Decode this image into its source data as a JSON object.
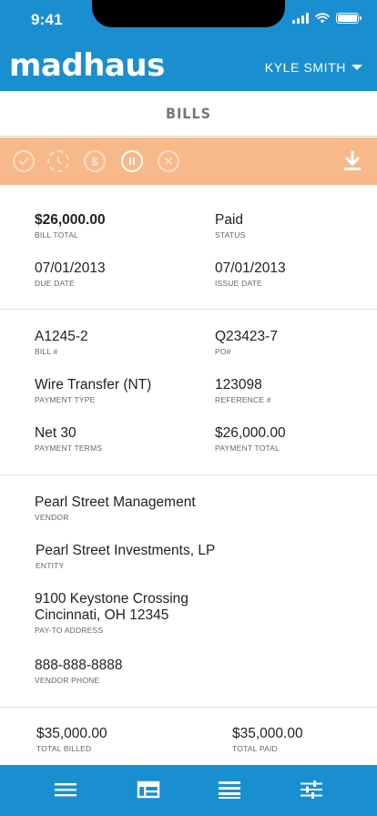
{
  "status_bar": {
    "time": "9:41"
  },
  "header": {
    "logo": "madhaus",
    "user_name": "KYLE SMITH",
    "brand_color": "#1a8fd0"
  },
  "page": {
    "title": "BILLS"
  },
  "action_bar": {
    "background": "#f7b98a",
    "actions": [
      "approve-icon",
      "pending-icon",
      "pay-icon",
      "hold-icon",
      "void-icon"
    ],
    "active_action": "hold-icon",
    "download_icon": "download-icon"
  },
  "summary": {
    "bill_total": {
      "value": "$26,000.00",
      "label": "BILL TOTAL"
    },
    "status": {
      "value": "Paid",
      "label": "STATUS"
    },
    "due_date": {
      "value": "07/01/2013",
      "label": "DUE DATE"
    },
    "issue_date": {
      "value": "07/01/2013",
      "label": "ISSUE DATE"
    }
  },
  "details": {
    "bill_no": {
      "value": "A1245-2",
      "label": "BILL #"
    },
    "po_no": {
      "value": "Q23423-7",
      "label": "PO#"
    },
    "payment_type": {
      "value": "Wire Transfer (NT)",
      "label": "PAYMENT TYPE"
    },
    "reference_no": {
      "value": "123098",
      "label": "REFERENCE #"
    },
    "payment_terms": {
      "value": "Net 30",
      "label": "PAYMENT TERMS"
    },
    "payment_total": {
      "value": "$26,000.00",
      "label": "PAYMENT TOTAL"
    }
  },
  "vendor": {
    "vendor": {
      "value": "Pearl Street Management",
      "label": "VENDOR"
    },
    "entity": {
      "value": "Pearl Street Investments, LP",
      "label": "ENTITY"
    },
    "address": {
      "line1": "9100 Keystone Crossing",
      "line2": "Cincinnati, OH 12345",
      "label": "PAY-TO ADDRESS"
    },
    "phone": {
      "value": "888-888-8888",
      "label": "VENDOR PHONE"
    }
  },
  "totals": {
    "total_billed": {
      "value": "$35,000.00",
      "label": "TOTAL BILLED"
    },
    "total_paid": {
      "value": "$35,000.00",
      "label": "TOTAL PAID"
    }
  },
  "bottom_nav": {
    "items": [
      "menu-icon",
      "dashboard-icon",
      "list-icon",
      "filters-icon"
    ]
  }
}
